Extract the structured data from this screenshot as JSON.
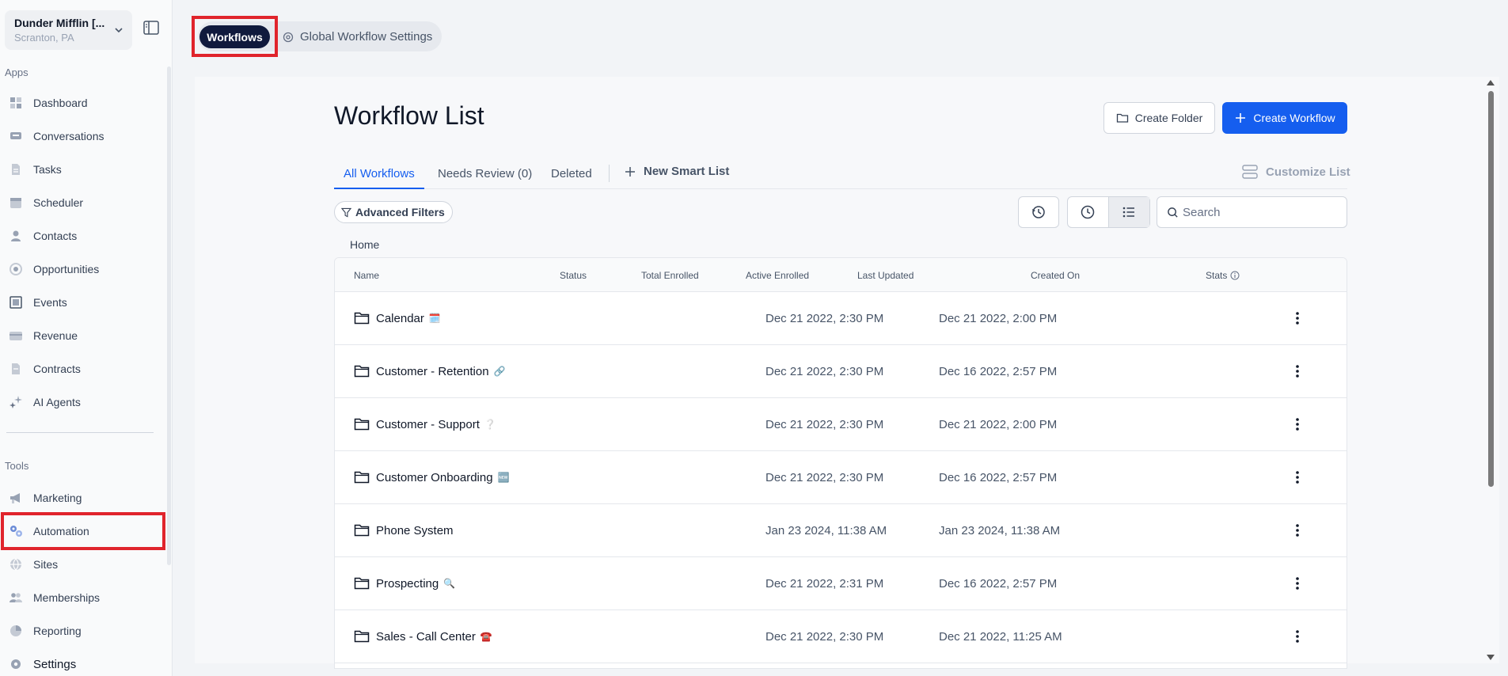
{
  "account": {
    "name": "Dunder Mifflin [...",
    "location": "Scranton, PA"
  },
  "sidebar": {
    "apps_label": "Apps",
    "apps": [
      {
        "label": "Dashboard",
        "icon": "dashboard-icon"
      },
      {
        "label": "Conversations",
        "icon": "chat-icon"
      },
      {
        "label": "Tasks",
        "icon": "tasks-icon"
      },
      {
        "label": "Scheduler",
        "icon": "calendar-icon"
      },
      {
        "label": "Contacts",
        "icon": "person-icon"
      },
      {
        "label": "Opportunities",
        "icon": "target-icon"
      },
      {
        "label": "Events",
        "icon": "events-icon"
      },
      {
        "label": "Revenue",
        "icon": "card-icon"
      },
      {
        "label": "Contracts",
        "icon": "document-icon"
      },
      {
        "label": "AI Agents",
        "icon": "sparkle-icon"
      }
    ],
    "tools_label": "Tools",
    "tools": [
      {
        "label": "Marketing",
        "icon": "megaphone-icon"
      },
      {
        "label": "Automation",
        "icon": "gears-icon"
      },
      {
        "label": "Sites",
        "icon": "globe-icon"
      },
      {
        "label": "Memberships",
        "icon": "people-icon"
      },
      {
        "label": "Reporting",
        "icon": "pie-icon"
      },
      {
        "label": "Settings",
        "icon": "gear-icon"
      }
    ]
  },
  "top_tabs": {
    "active": "Workflows",
    "other": "Global Workflow Settings"
  },
  "main": {
    "title": "Workflow List",
    "create_folder": "Create Folder",
    "create_workflow": "Create Workflow",
    "tabs": [
      "All Workflows",
      "Needs Review (0)",
      "Deleted"
    ],
    "new_smart_list": "New Smart List",
    "customize_list": "Customize List",
    "advanced_filters": "Advanced Filters",
    "search_placeholder": "Search",
    "breadcrumb": "Home",
    "columns": [
      "Name",
      "Status",
      "Total Enrolled",
      "Active Enrolled",
      "Last Updated",
      "Created On",
      "Stats"
    ],
    "rows": [
      {
        "name": "Calendar",
        "emoji": "🗓️",
        "last_updated": "Dec 21 2022, 2:30 PM",
        "created_on": "Dec 21 2022, 2:00 PM"
      },
      {
        "name": "Customer - Retention",
        "emoji": "🔗",
        "last_updated": "Dec 21 2022, 2:30 PM",
        "created_on": "Dec 16 2022, 2:57 PM"
      },
      {
        "name": "Customer - Support",
        "emoji": "❔",
        "last_updated": "Dec 21 2022, 2:30 PM",
        "created_on": "Dec 21 2022, 2:00 PM"
      },
      {
        "name": "Customer Onboarding",
        "emoji": "🆕",
        "last_updated": "Dec 21 2022, 2:30 PM",
        "created_on": "Dec 16 2022, 2:57 PM"
      },
      {
        "name": "Phone System",
        "emoji": "",
        "last_updated": "Jan 23 2024, 11:38 AM",
        "created_on": "Jan 23 2024, 11:38 AM"
      },
      {
        "name": "Prospecting",
        "emoji": "🔍",
        "last_updated": "Dec 21 2022, 2:31 PM",
        "created_on": "Dec 16 2022, 2:57 PM"
      },
      {
        "name": "Sales - Call Center",
        "emoji": "☎️",
        "last_updated": "Dec 21 2022, 2:30 PM",
        "created_on": "Dec 21 2022, 11:25 AM"
      }
    ]
  },
  "colors": {
    "accent": "#155eef",
    "active_tab_bg": "#101a3d",
    "highlight": "#e0242c"
  }
}
